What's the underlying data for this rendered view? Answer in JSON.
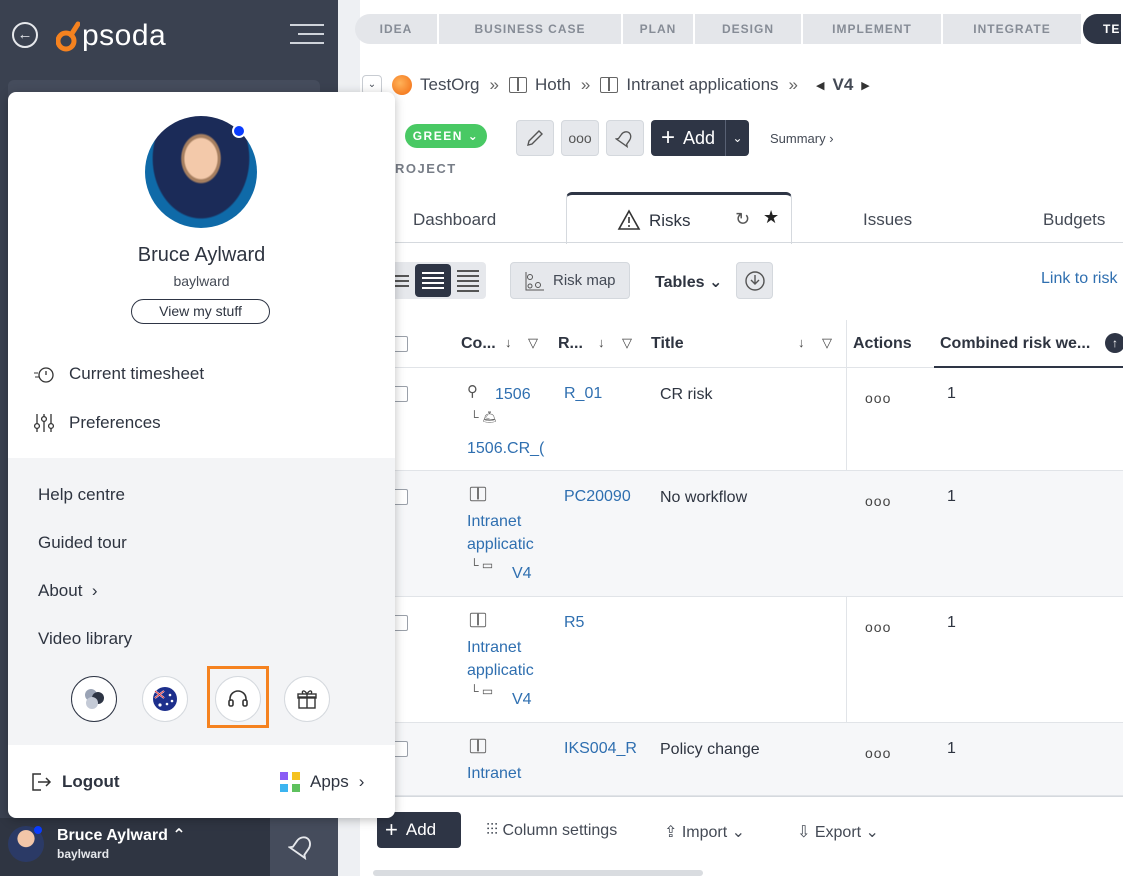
{
  "brand": {
    "logo_text": "psoda"
  },
  "stages": [
    "IDEA",
    "BUSINESS CASE",
    "PLAN",
    "DESIGN",
    "IMPLEMENT",
    "INTEGRATE",
    "TES"
  ],
  "breadcrumb": {
    "org": "TestOrg",
    "portfolio": "Hoth",
    "program": "Intranet applications",
    "version": "V4"
  },
  "status": {
    "label": "GREEN"
  },
  "toolbar": {
    "add_label": "Add",
    "summary_label": "Summary ›"
  },
  "project_label": "ROJECT",
  "tabs": {
    "dashboard": "Dashboard",
    "risks": "Risks",
    "issues": "Issues",
    "budgets": "Budgets"
  },
  "view_controls": {
    "risk_map": "Risk map",
    "tables": "Tables",
    "link": "Link to risk"
  },
  "table": {
    "headers": {
      "code": "Co...",
      "ref": "R...",
      "title": "Title",
      "actions": "Actions",
      "combined": "Combined risk we..."
    },
    "rows": [
      {
        "code1": "1506",
        "code2": "1506.CR_(",
        "ref": "R_01",
        "title": "CR risk",
        "weight": "1"
      },
      {
        "code1": "Intranet",
        "code1b": "applicatic",
        "code2": "V4",
        "ref": "PC20090",
        "title": "No workflow",
        "weight": "1"
      },
      {
        "code1": "Intranet",
        "code1b": "applicatic",
        "code2": "V4",
        "ref": "R5",
        "title": "",
        "weight": "1"
      },
      {
        "code1": "Intranet",
        "ref": "IKS004_R",
        "title": "Policy change",
        "weight": "1"
      }
    ],
    "actions_glyph": "ooo"
  },
  "bottom_bar": {
    "add": "Add",
    "column_settings": "Column settings",
    "import": "Import",
    "export": "Export"
  },
  "user_panel": {
    "name": "Bruce Aylward",
    "username": "baylward",
    "view_my_stuff": "View my stuff",
    "menu": [
      "Current timesheet",
      "Preferences"
    ],
    "links": [
      "Help centre",
      "Guided tour",
      "About",
      "Video library"
    ],
    "logout": "Logout",
    "apps": "Apps"
  },
  "sidebar_footer": {
    "name": "Bruce Aylward",
    "username": "baylward"
  },
  "colors": {
    "accent_dark": "#2e3545",
    "green": "#49c964",
    "orange": "#f5821f",
    "link": "#2f6fb0"
  }
}
